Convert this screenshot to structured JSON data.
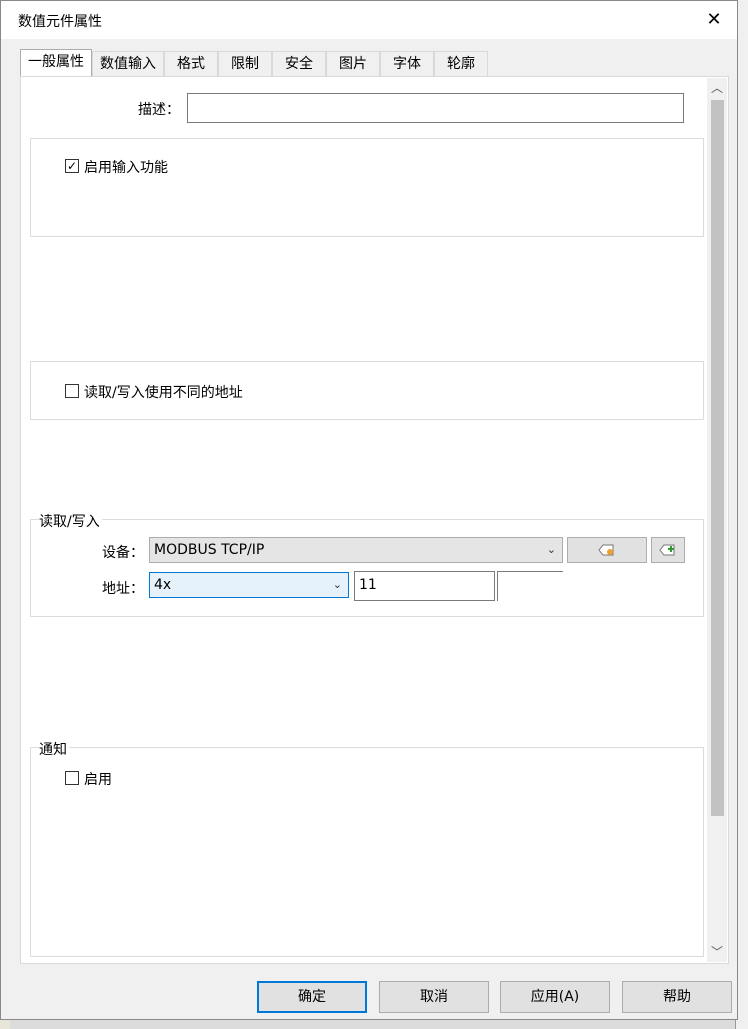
{
  "dialog": {
    "title": "数值元件属性",
    "close_glyph": "✕"
  },
  "tabs": [
    {
      "label": "一般属性"
    },
    {
      "label": "数值输入"
    },
    {
      "label": "格式"
    },
    {
      "label": "限制"
    },
    {
      "label": "安全"
    },
    {
      "label": "图片"
    },
    {
      "label": "字体"
    },
    {
      "label": "轮廓"
    }
  ],
  "general": {
    "description_label": "描述：",
    "description_value": "",
    "enable_input_label": "启用输入功能",
    "enable_input_checked": true,
    "diff_address_label": "读取/写入使用不同的地址",
    "diff_address_checked": false
  },
  "readwrite": {
    "legend": "读取/写入",
    "device_label": "设备：",
    "device_value": "MODBUS TCP/IP",
    "address_label": "地址：",
    "address_type": "4x",
    "address_value": "11",
    "tag_icon": "tag-settings-icon",
    "add_tag_icon": "add-tag-icon"
  },
  "notify": {
    "legend": "通知",
    "enable_label": "启用",
    "enable_checked": false
  },
  "buttons": {
    "ok": "确定",
    "cancel": "取消",
    "apply": "应用(A)",
    "help": "帮助"
  },
  "scroll_glyphs": {
    "up": "︿",
    "down": "﹀"
  },
  "colors": {
    "accent": "#0078d7",
    "checkbox_check": "✓"
  }
}
